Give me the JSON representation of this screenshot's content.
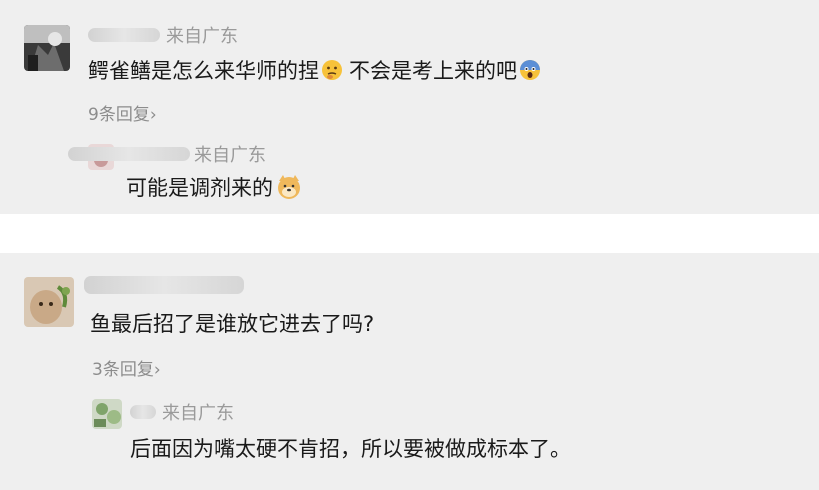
{
  "comments": [
    {
      "location": "来自广东",
      "text": "鳄雀鳝是怎么来华师的捏",
      "text_after_emoji": "不会是考上来的吧",
      "reply_count": "9条回复",
      "reply_chevron": "›",
      "emoji_1": "thinking-face-icon",
      "emoji_2": "screaming-face-icon",
      "reply": {
        "location": "来自广东",
        "text": "可能是调剂来的",
        "emoji": "doge-icon"
      }
    },
    {
      "location": "",
      "text": "鱼最后招了是谁放它进去了吗?",
      "reply_count": "3条回复",
      "reply_chevron": "›",
      "reply": {
        "location": "来自广东",
        "text": "后面因为嘴太硬不肯招，所以要被做成标本了。"
      }
    }
  ],
  "colors": {
    "card_bg": "#efefef",
    "name_gray": "#9a9a9a",
    "reply_count_gray": "#8c8c8c"
  }
}
